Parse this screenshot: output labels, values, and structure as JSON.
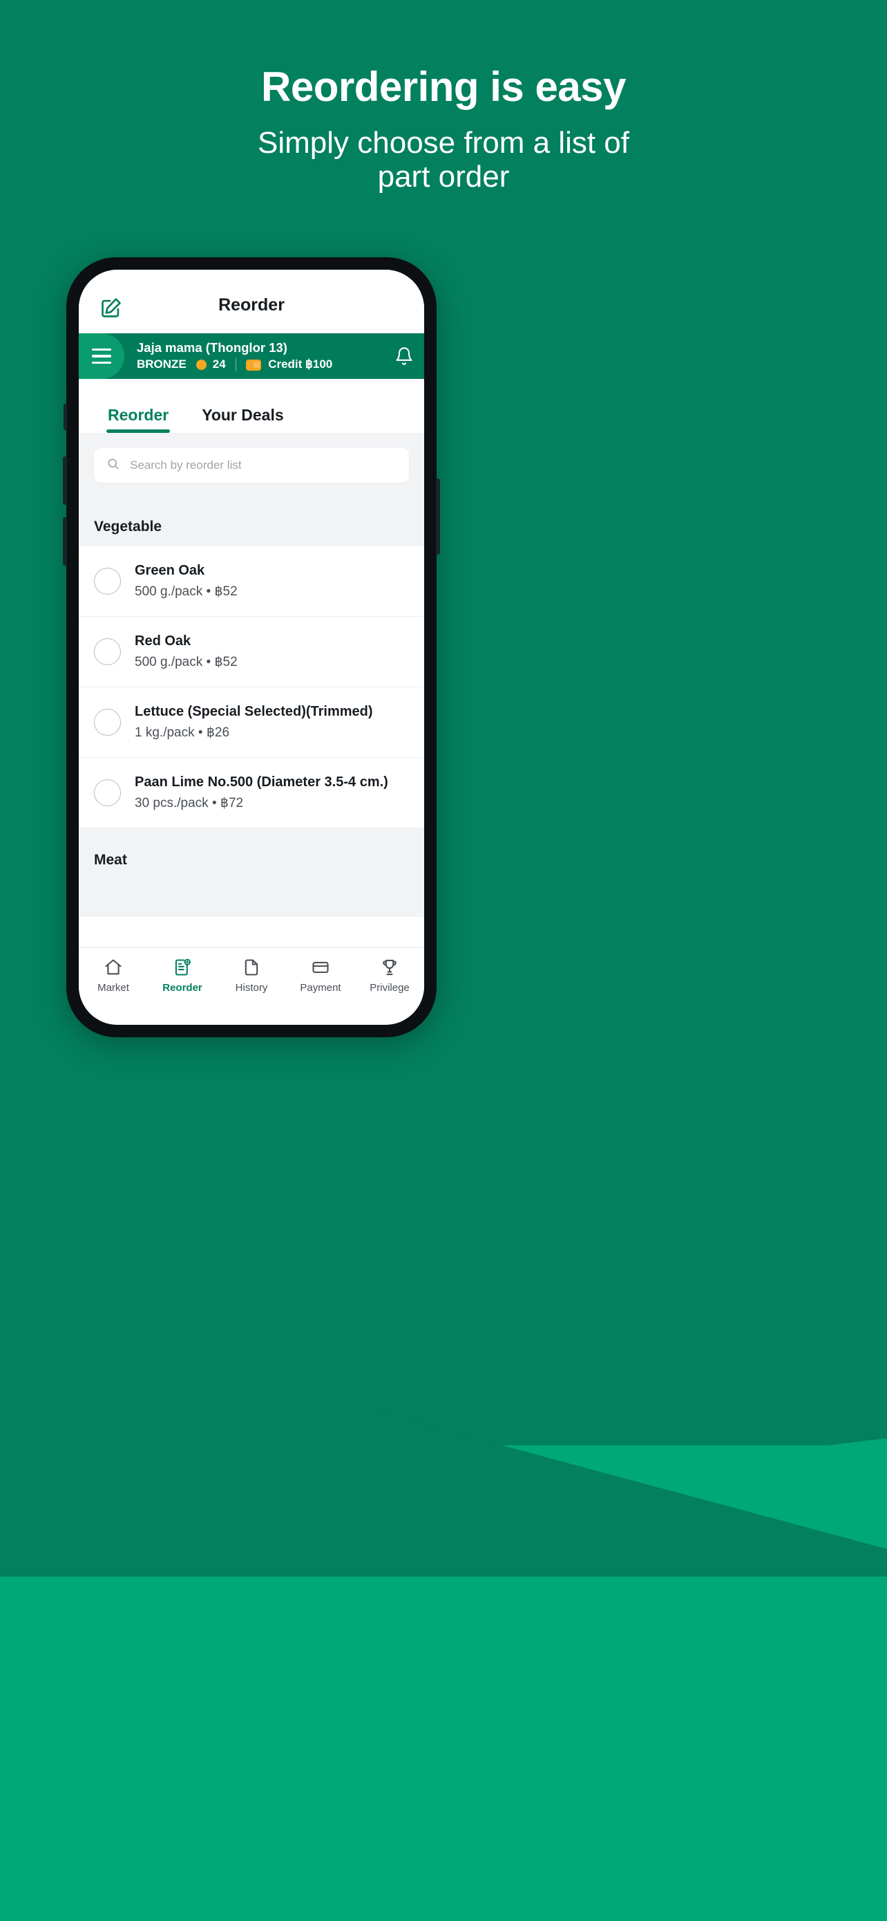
{
  "hero": {
    "headline": "Reordering is easy",
    "subline1": "Simply choose from a list of",
    "subline2": "part order"
  },
  "colors": {
    "background_top": "#03805E",
    "background_bottom": "#00A878",
    "brand_green": "#03805E",
    "header_green": "#017C5B",
    "hamburger_green": "#0A9C6F",
    "accent_orange": "#F5A623"
  },
  "app": {
    "header": {
      "title": "Reorder",
      "edit_icon": "edit-square-icon"
    },
    "user_bar": {
      "menu_icon": "hamburger-menu-icon",
      "name": "Jaja mama (Thonglor 13)",
      "tier": "BRONZE",
      "points_icon": "coin-icon",
      "points": "24",
      "wallet_icon": "wallet-icon",
      "credit_label": "Credit ฿100",
      "bell_icon": "bell-icon"
    },
    "tabs": [
      {
        "label": "Reorder",
        "active": true
      },
      {
        "label": "Your Deals",
        "active": false
      }
    ],
    "search": {
      "icon": "search-icon",
      "placeholder": "Search by reorder list",
      "value": ""
    },
    "sections": [
      {
        "title": "Vegetable",
        "items": [
          {
            "name": "Green Oak",
            "detail": "500 g./pack • ฿52",
            "selected": false
          },
          {
            "name": "Red Oak",
            "detail": "500 g./pack • ฿52",
            "selected": false
          },
          {
            "name": "Lettuce (Special Selected)(Trimmed)",
            "detail": "1 kg./pack • ฿26",
            "selected": false
          },
          {
            "name": "Paan Lime No.500 (Diameter 3.5-4 cm.)",
            "detail": "30 pcs./pack • ฿72",
            "selected": false
          }
        ]
      },
      {
        "title": "Meat",
        "items": []
      }
    ],
    "bottom_nav": [
      {
        "label": "Market",
        "icon": "home-icon",
        "active": false
      },
      {
        "label": "Reorder",
        "icon": "reorder-list-icon",
        "active": true
      },
      {
        "label": "History",
        "icon": "document-icon",
        "active": false
      },
      {
        "label": "Payment",
        "icon": "card-icon",
        "active": false
      },
      {
        "label": "Privilege",
        "icon": "trophy-icon",
        "active": false
      }
    ]
  }
}
